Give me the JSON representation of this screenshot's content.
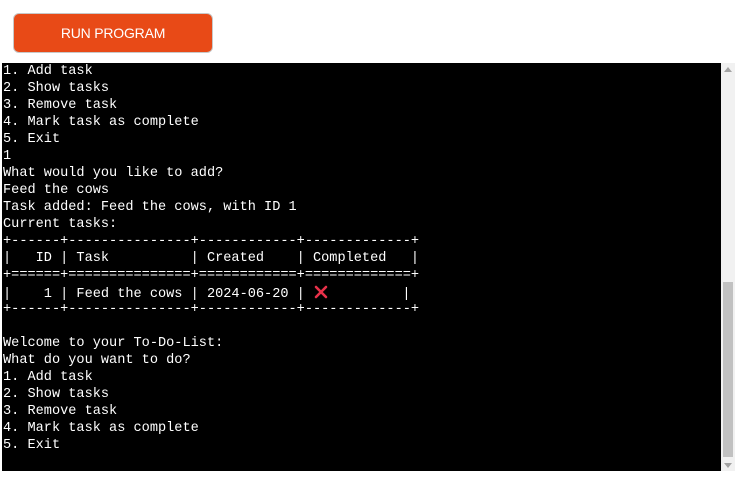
{
  "run_button": {
    "label": "RUN PROGRAM"
  },
  "colors": {
    "accent": "#e84a17",
    "terminal_bg": "#000000",
    "terminal_fg": "#ffffff",
    "cross": "#e8314a"
  },
  "terminal": {
    "lines": [
      "1. Add task",
      "2. Show tasks",
      "3. Remove task",
      "4. Mark task as complete",
      "5. Exit",
      "1",
      "What would you like to add?",
      "Feed the cows",
      "Task added: Feed the cows, with ID 1",
      "Current tasks:",
      "+------+---------------+------------+-------------+",
      "|   ID | Task          | Created    | Completed   |",
      "+======+===============+============+=============+",
      "|    1 | Feed the cows | 2024-06-20 | ",
      "+------+---------------+------------+-------------+",
      "",
      "Welcome to your To-Do-List:",
      "What do you want to do?",
      "1. Add task",
      "2. Show tasks",
      "3. Remove task",
      "4. Mark task as complete",
      "5. Exit"
    ],
    "row_tail": "         |",
    "completed_icon": "cross-mark-icon"
  }
}
